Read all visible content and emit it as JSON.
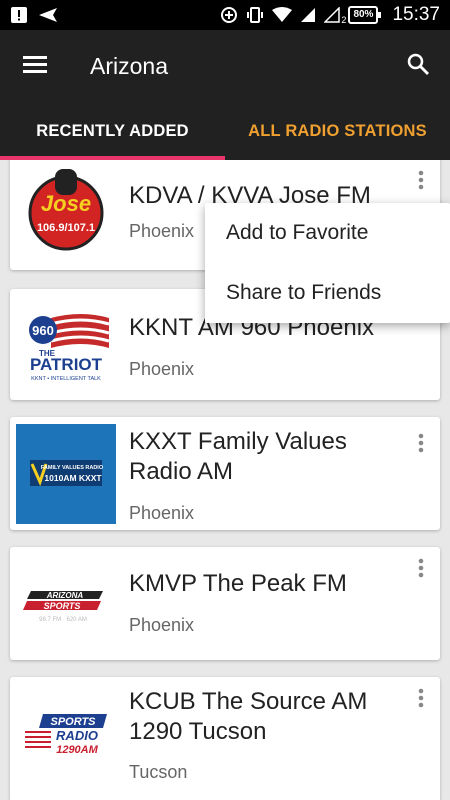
{
  "status_bar": {
    "battery": "80%",
    "sim_label": "2",
    "time": "15:37"
  },
  "app_bar": {
    "title": "Arizona"
  },
  "tabs": [
    {
      "label": "RECENTLY ADDED",
      "active": true
    },
    {
      "label": "ALL RADIO STATIONS",
      "active": false
    }
  ],
  "stations": [
    {
      "name": "KDVA / KVVA Jose FM",
      "city": "Phoenix",
      "logo": "jose-logo",
      "logo_text": [
        "Jose",
        "106.9/107.1"
      ]
    },
    {
      "name": "KKNT AM 960 Phoenix",
      "city": "Phoenix",
      "logo": "patriot-logo",
      "logo_text": [
        "960",
        "THE",
        "PATRIOT",
        "KKNT • INTELLIGENT TALK"
      ]
    },
    {
      "name": "KXXT Family Values Radio AM",
      "city": "Phoenix",
      "logo": "family-values-logo",
      "logo_text": [
        "FAMILY VALUES RADIO",
        "1010AM KXXT"
      ]
    },
    {
      "name": "KMVP The Peak FM",
      "city": "Phoenix",
      "logo": "arizona-sports-logo",
      "logo_text": [
        "ARIZONA",
        "SPORTS",
        "98.7 FM · 620 AM"
      ]
    },
    {
      "name": "KCUB The Source AM 1290 Tucson",
      "city": "Tucson",
      "logo": "sports-radio-logo",
      "logo_text": [
        "SPORTS",
        "RADIO",
        "1290AM"
      ]
    }
  ],
  "popup_menu": {
    "items": [
      "Add to Favorite",
      "Share to Friends"
    ]
  },
  "colors": {
    "app_bar": "#212121",
    "tab_indicator": "#e8356b",
    "inactive_tab": "#f0a030",
    "list_background": "#e8e8e8"
  }
}
